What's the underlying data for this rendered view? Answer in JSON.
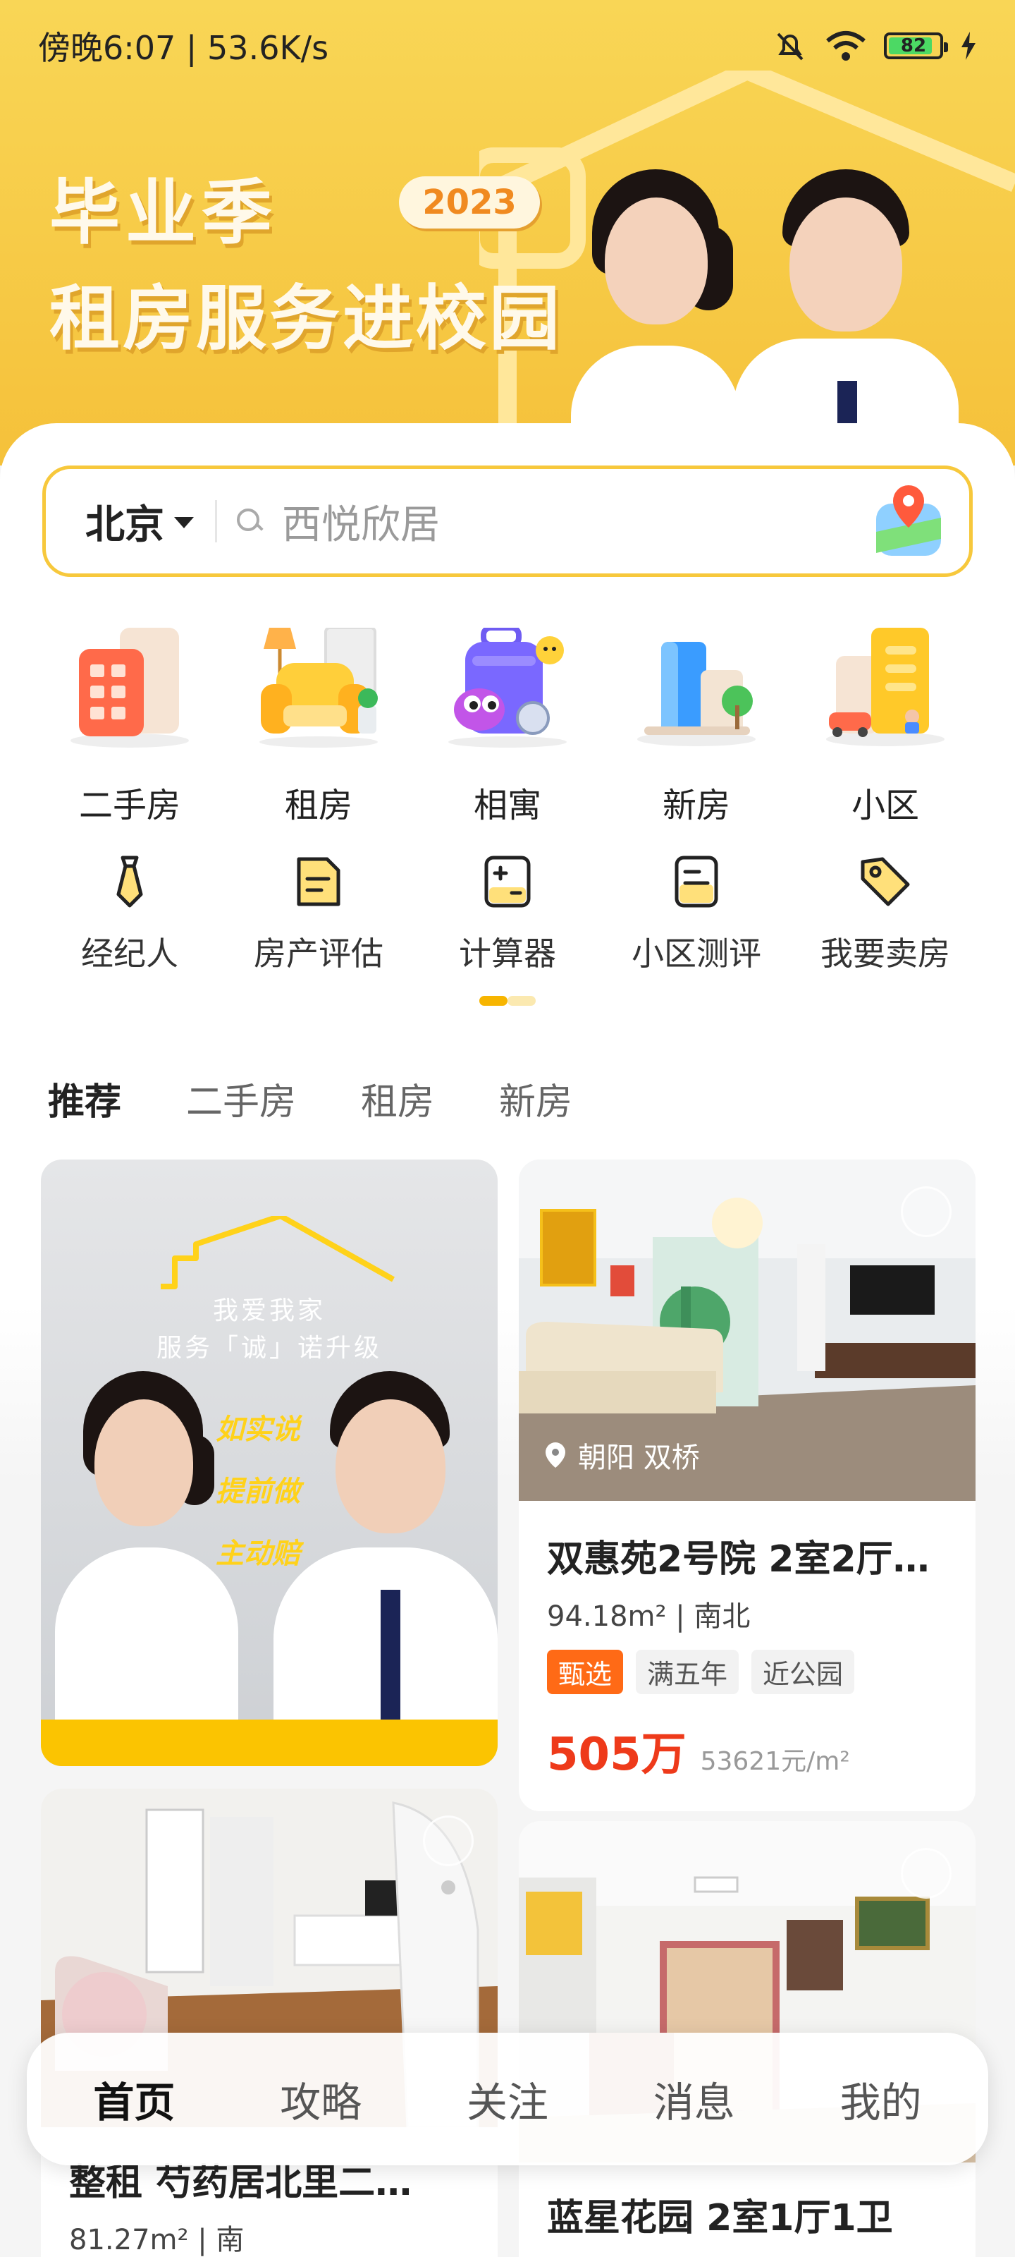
{
  "status_bar": {
    "time_speed": "傍晚6:07 | 53.6K/s",
    "battery": "82"
  },
  "banner": {
    "line1": "毕业季",
    "line2": "租房服务进校园",
    "year": "2023"
  },
  "search": {
    "city": "北京",
    "placeholder": "西悦欣居"
  },
  "categories": [
    {
      "label": "二手房",
      "icon": "building-icon"
    },
    {
      "label": "租房",
      "icon": "sofa-icon"
    },
    {
      "label": "相寓",
      "icon": "suitcase-mascot-icon"
    },
    {
      "label": "新房",
      "icon": "new-building-icon"
    },
    {
      "label": "小区",
      "icon": "community-icon"
    }
  ],
  "tools": [
    {
      "label": "经纪人",
      "icon": "tie-icon"
    },
    {
      "label": "房产评估",
      "icon": "document-icon"
    },
    {
      "label": "计算器",
      "icon": "calculator-icon"
    },
    {
      "label": "小区测评",
      "icon": "report-icon"
    },
    {
      "label": "我要卖房",
      "icon": "price-tag-icon"
    }
  ],
  "feed_tabs": [
    "推荐",
    "二手房",
    "租房",
    "新房"
  ],
  "ad_card": {
    "line1": "我爱我家",
    "line2": "服务「诚」诺升级",
    "slogans": [
      "如实说",
      "提前做",
      "主动赔"
    ]
  },
  "listings": [
    {
      "location": "朝阳 双桥",
      "title": "双惠苑2号院 2室2厅…",
      "meta": "94.18m² | 南北",
      "tags": [
        "甄选",
        "满五年",
        "近公园"
      ],
      "price": "505万",
      "unit_price": "53621元/m²"
    },
    {
      "title": "整租 芍药居北里二…",
      "meta": "81.27m² | 南"
    },
    {
      "title": "蓝星花园 2室1厅1卫"
    }
  ],
  "bottom_nav": [
    "首页",
    "攻略",
    "关注",
    "消息",
    "我的"
  ],
  "colors": {
    "accent": "#f7c83c",
    "price": "#ee3a1a",
    "tag_highlight": "#ff6a16"
  }
}
